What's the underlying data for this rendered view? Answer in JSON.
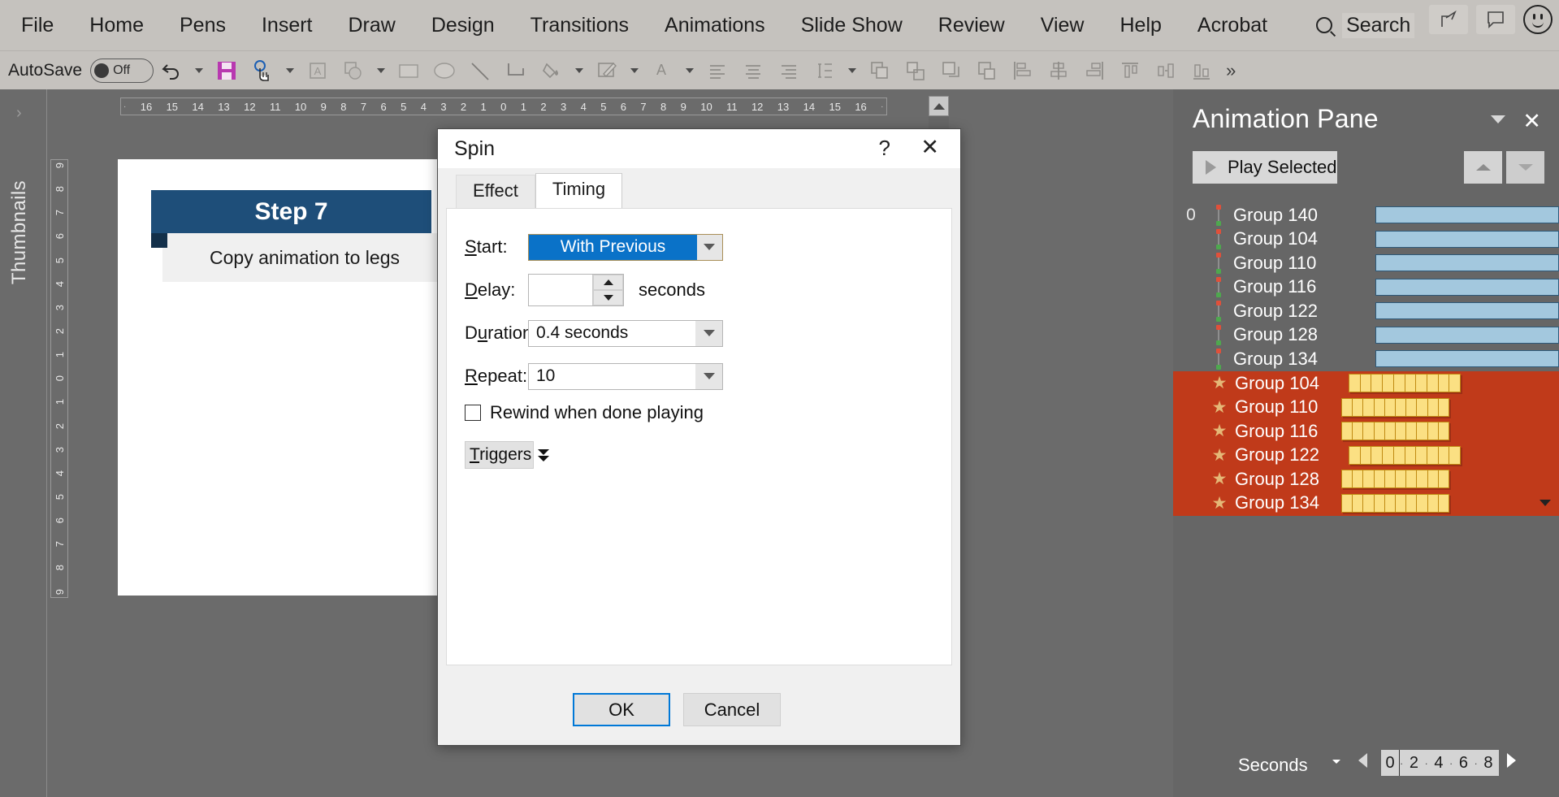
{
  "menubar": {
    "items": [
      "File",
      "Home",
      "Pens",
      "Insert",
      "Draw",
      "Design",
      "Transitions",
      "Animations",
      "Slide Show",
      "Review",
      "View",
      "Help",
      "Acrobat"
    ],
    "search_label": "Search"
  },
  "toolbar": {
    "autosave_label": "AutoSave",
    "autosave_state": "Off",
    "overflow_label": "»"
  },
  "rail": {
    "thumbnails_label": "Thumbnails"
  },
  "rulers": {
    "horizontal": [
      "16",
      "15",
      "14",
      "13",
      "12",
      "11",
      "10",
      "9",
      "8",
      "7",
      "6",
      "5",
      "4",
      "3",
      "2",
      "1",
      "0",
      "1",
      "2",
      "3",
      "4",
      "5",
      "6",
      "7",
      "8",
      "9",
      "10",
      "11",
      "12",
      "13",
      "14",
      "15",
      "16"
    ],
    "vertical": [
      "9",
      "8",
      "7",
      "6",
      "5",
      "4",
      "3",
      "2",
      "1",
      "0",
      "1",
      "2",
      "3",
      "4",
      "5",
      "6",
      "7",
      "8",
      "9"
    ]
  },
  "slide": {
    "step_title": "Step 7",
    "step_body": "Copy animation to legs"
  },
  "dialog": {
    "title": "Spin",
    "help_glyph": "?",
    "close_glyph": "✕",
    "tabs": [
      {
        "label": "Effect",
        "active": false
      },
      {
        "label": "Timing",
        "active": true
      }
    ],
    "fields": {
      "start_label": "Start:",
      "start_value": "With Previous",
      "delay_label": "Delay:",
      "delay_value": "",
      "delay_units": "seconds",
      "duration_label": "Duration:",
      "duration_value": "0.4 seconds",
      "repeat_label": "Repeat:",
      "repeat_value": "10",
      "rewind_label": "Rewind when done playing",
      "rewind_checked": false,
      "triggers_label": "Triggers"
    },
    "buttons": {
      "ok": "OK",
      "cancel": "Cancel"
    },
    "accent_color": "#0a72c8",
    "focus_color": "#0078d7"
  },
  "animation_pane": {
    "title": "Animation Pane",
    "dropdown_glyph": "▾",
    "close_glyph": "✕",
    "play_button": "Play Selected",
    "start_number": "0",
    "unselected_items": [
      {
        "name": "Group 140",
        "number": "0"
      },
      {
        "name": "Group 104",
        "number": ""
      },
      {
        "name": "Group 110",
        "number": ""
      },
      {
        "name": "Group 116",
        "number": ""
      },
      {
        "name": "Group 122",
        "number": ""
      },
      {
        "name": "Group 128",
        "number": ""
      },
      {
        "name": "Group 134",
        "number": ""
      }
    ],
    "selected_items": [
      {
        "name": "Group 104",
        "segments": 10,
        "offset": 16
      },
      {
        "name": "Group 110",
        "segments": 10,
        "offset": 7
      },
      {
        "name": "Group 116",
        "segments": 10,
        "offset": 7
      },
      {
        "name": "Group 122",
        "segments": 10,
        "offset": 16
      },
      {
        "name": "Group 128",
        "segments": 10,
        "offset": 7
      },
      {
        "name": "Group 134",
        "segments": 10,
        "offset": 7
      }
    ],
    "selection_color": "#c03a1a",
    "bar_color": "#a3c8de",
    "selected_bar_color": "#fbe083",
    "footer": {
      "seconds_label": "Seconds",
      "scale_zero": "0",
      "scale_ticks": [
        "2",
        "4",
        "6",
        "8"
      ]
    }
  }
}
